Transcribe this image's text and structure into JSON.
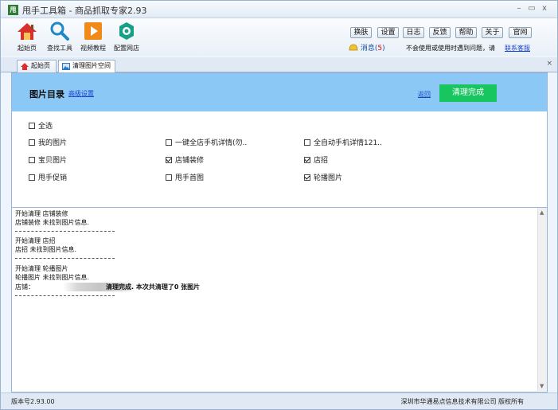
{
  "window": {
    "title": "甩手工具箱 - 商品抓取专家2.93",
    "logo_text": "甩",
    "minimize": "–",
    "maximize": "▭",
    "close": "x"
  },
  "toolbar": {
    "items": [
      {
        "label": "起始页",
        "icon": "home-icon"
      },
      {
        "label": "查找工具",
        "icon": "search-icon"
      },
      {
        "label": "视频教程",
        "icon": "play-icon"
      },
      {
        "label": "配置网店",
        "icon": "gear-icon"
      }
    ],
    "buttons": [
      "换肤",
      "设置",
      "日志",
      "反馈",
      "帮助",
      "关于",
      "官网"
    ],
    "message_label": "消息(",
    "message_count": "5",
    "message_end": ")",
    "notice": "不会使用或使用时遇到问题，请",
    "contact_link": "联系客服"
  },
  "tabs": [
    {
      "label": "起始页",
      "icon": "home-icon",
      "active": false
    },
    {
      "label": "清理图片空间",
      "icon": "image-icon",
      "active": true
    }
  ],
  "tab_close": "×",
  "header": {
    "title": "图片目录",
    "advanced_link": "高级设置",
    "back_link": "返回",
    "done_button": "清理完成"
  },
  "options": {
    "select_all": {
      "label": "全选",
      "checked": false
    },
    "rows": [
      [
        {
          "label": "我的图片",
          "checked": false
        },
        {
          "label": "一键全店手机详情(勿..",
          "checked": false
        },
        {
          "label": "全自动手机详情121..",
          "checked": false
        }
      ],
      [
        {
          "label": "宝贝图片",
          "checked": false
        },
        {
          "label": "店铺装修",
          "checked": true
        },
        {
          "label": "店招",
          "checked": true
        }
      ],
      [
        {
          "label": "甩手促销",
          "checked": false
        },
        {
          "label": "甩手首图",
          "checked": false
        },
        {
          "label": "轮播图片",
          "checked": true
        }
      ]
    ]
  },
  "log": {
    "lines": [
      "开始清理 店铺装修",
      "店铺装修 未找到图片信息.",
      "开始清理 店招",
      "店招 未找到图片信息.",
      "开始清理 轮播图片",
      "轮播图片 未找到图片信息.",
      "店铺：",
      "清理完成. 本次共清理了0 张图片"
    ]
  },
  "status": {
    "version": "版本号2.93.00",
    "company": "深圳市华通易点信息技术有限公司 版权所有"
  },
  "colors": {
    "accent_header": "#8cc8f5",
    "done_button": "#17c65f",
    "link": "#1a44c8"
  }
}
